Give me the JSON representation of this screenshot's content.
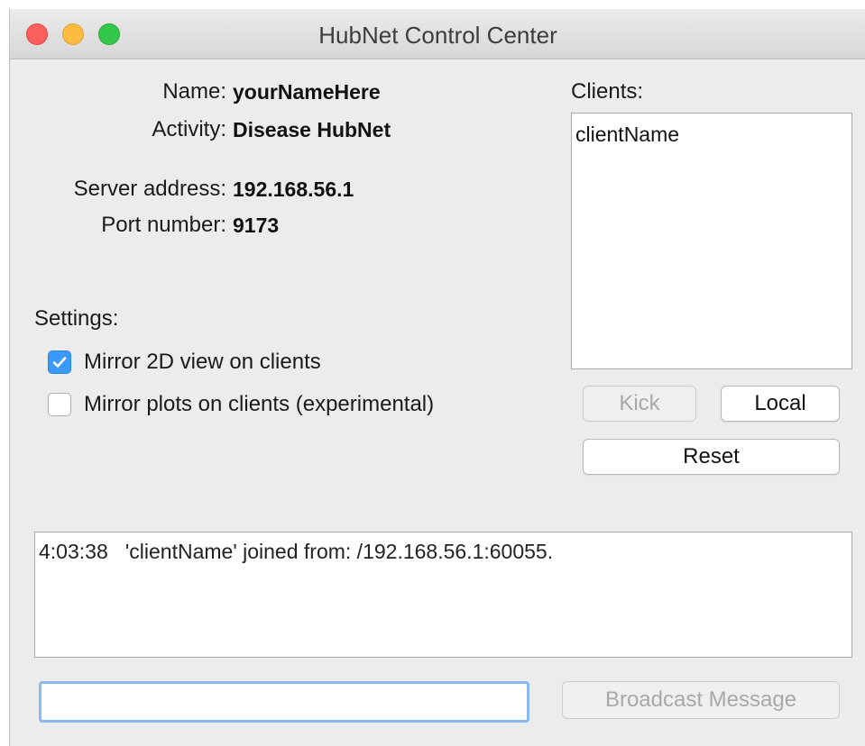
{
  "window": {
    "title": "HubNet Control Center"
  },
  "info": {
    "name_label": "Name:",
    "name_value": "yourNameHere",
    "activity_label": "Activity:",
    "activity_value": "Disease HubNet",
    "server_label": "Server address:",
    "server_value": "192.168.56.1",
    "port_label": "Port number:",
    "port_value": "9173"
  },
  "settings": {
    "heading": "Settings:",
    "options": [
      {
        "label": "Mirror 2D view on clients",
        "checked": true
      },
      {
        "label": "Mirror plots on clients (experimental)",
        "checked": false
      }
    ]
  },
  "clients": {
    "heading": "Clients:",
    "items": [
      "clientName"
    ],
    "kick_label": "Kick",
    "local_label": "Local",
    "reset_label": "Reset"
  },
  "log": {
    "lines": [
      "4:03:38   'clientName' joined from: /192.168.56.1:60055."
    ]
  },
  "broadcast": {
    "input_value": "",
    "button_label": "Broadcast Message"
  },
  "colors": {
    "close": "#fc605c",
    "minimize": "#fdbc40",
    "maximize": "#34c84a",
    "checkbox_checked": "#3b99fc",
    "focus_ring": "#8ab8f2"
  }
}
